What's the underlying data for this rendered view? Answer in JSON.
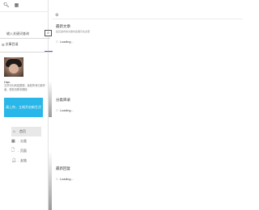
{
  "sidebar": {
    "topbar": {
      "left_icon": "search-icon",
      "right_icon": "grid-icon"
    },
    "search": {
      "placeholder": "输入关键词查询",
      "button_icon": "search-icon"
    },
    "toc": {
      "label": "文章目录",
      "icon": "list-icon"
    },
    "profile": {
      "name": "Han",
      "bio": "文章均为转载整理，版权所有归原作者，侵权请联系删除"
    },
    "login_banner": {
      "text": "请上你，立刻开启新生活"
    },
    "nav": [
      {
        "label": "首页",
        "icon": "home-icon",
        "active": true
      },
      {
        "label": "分类",
        "icon": "grid-icon",
        "active": false
      },
      {
        "label": "页面",
        "icon": "document-icon",
        "active": false
      },
      {
        "label": "友链",
        "icon": "person-icon",
        "active": false
      }
    ]
  },
  "main": {
    "sections": [
      {
        "title": "最新文章",
        "subtitle": "最近发布的文章将会展示在这里",
        "loading": "Loading..."
      },
      {
        "title": "分类目录",
        "subtitle": "",
        "loading": "Loading..."
      },
      {
        "title": "最新回复",
        "subtitle": "",
        "loading": "Loading..."
      }
    ]
  },
  "colors": {
    "login_banner": "#29b6e8",
    "accent_line": "#6a5acd",
    "active_nav_bg": "#e8e8e8"
  }
}
